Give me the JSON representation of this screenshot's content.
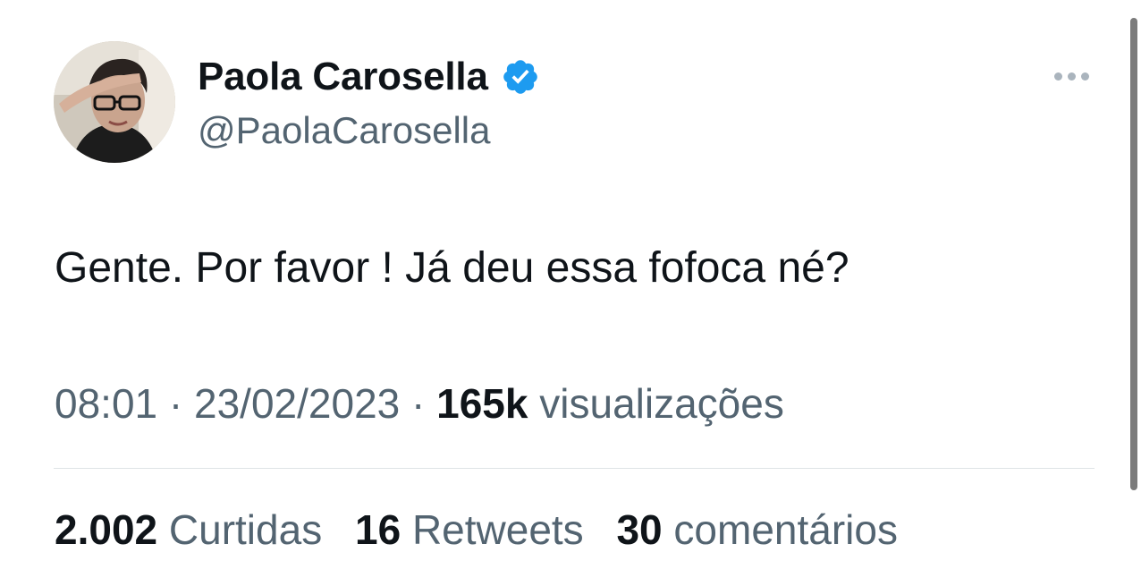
{
  "author": {
    "display_name": "Paola Carosella",
    "handle": "@PaolaCarosella",
    "verified": true,
    "avatar_icon": "profile-photo"
  },
  "tweet": {
    "text": "Gente. Por favor ! Já deu essa fofoca né?",
    "time": "08:01",
    "separator": "·",
    "date": "23/02/2023",
    "views_count": "165k",
    "views_label": "visualizações"
  },
  "stats": {
    "likes_count": "2.002",
    "likes_label": "Curtidas",
    "retweets_count": "16",
    "retweets_label": "Retweets",
    "comments_count": "30",
    "comments_label": "comentários"
  },
  "colors": {
    "text_primary": "#0f1419",
    "text_secondary": "#536471",
    "verified_blue": "#1d9bf0",
    "divider": "#dfe3e6"
  },
  "icons": {
    "verified": "verified-badge-icon",
    "more": "more-options-icon"
  }
}
